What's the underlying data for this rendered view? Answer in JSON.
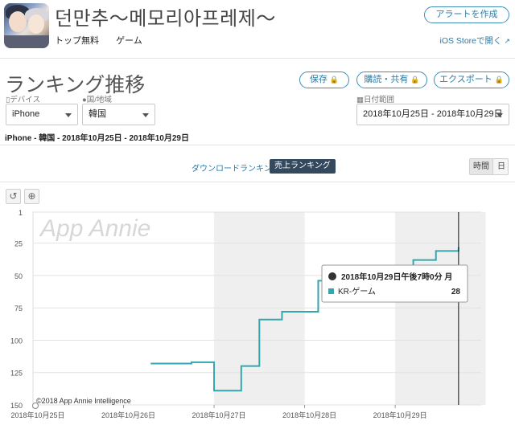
{
  "app": {
    "title": "던만추～메모리아프레제～",
    "price": "トップ無料",
    "category": "ゲーム"
  },
  "header": {
    "alert_button": "アラートを作成",
    "ios_store_link": "iOS Storeで開く"
  },
  "page": {
    "title": "ランキング推移",
    "save_button": "保存",
    "subscribe_button": "購読・共有",
    "export_button": "エクスポート"
  },
  "filters": {
    "device_label": "デバイス",
    "device_value": "iPhone",
    "country_label": "国/地域",
    "country_value": "韓国",
    "date_label": "日付範囲",
    "date_value": "2018年10月25日 - 2018年10月29日"
  },
  "summary": "iPhone - 韓国 - 2018年10月25日 - 2018年10月29日",
  "tabs": {
    "download": "ダウンロードランキング",
    "revenue": "売上ランキング",
    "hourly": "時間",
    "daily": "日"
  },
  "tooltip": {
    "header": "2018年10月29日午後7時0分 月",
    "series": "KR-ゲーム",
    "value": "28"
  },
  "watermark": "App Annie",
  "credit": "©2018 App Annie Intelligence",
  "colors": {
    "accent": "#2b7ca6",
    "series": "#35a6ad",
    "tab_active": "#34495e"
  },
  "chart_data": {
    "type": "line",
    "y_reversed": true,
    "ylim": [
      1,
      150
    ],
    "yticks": [
      "1",
      "25",
      "50",
      "75",
      "100",
      "125",
      "150"
    ],
    "xticks": [
      "2018年10月25日",
      "2018年10月26日",
      "2018年10月27日",
      "2018年10月28日",
      "2018年10月29日"
    ],
    "xlim_days": [
      25,
      29.95
    ],
    "shaded_day": "2018年10月27日",
    "series": [
      {
        "name": "KR-ゲーム",
        "points": [
          [
            26.3,
            118
          ],
          [
            26.75,
            118
          ],
          [
            26.75,
            117
          ],
          [
            27.0,
            117
          ],
          [
            27.0,
            139
          ],
          [
            27.3,
            139
          ],
          [
            27.3,
            120
          ],
          [
            27.5,
            120
          ],
          [
            27.5,
            84
          ],
          [
            27.75,
            84
          ],
          [
            27.75,
            78
          ],
          [
            28.15,
            78
          ],
          [
            28.15,
            54
          ],
          [
            28.3,
            54
          ],
          [
            28.3,
            52
          ],
          [
            28.5,
            52
          ],
          [
            28.5,
            47
          ],
          [
            29.2,
            47
          ],
          [
            29.2,
            38
          ],
          [
            29.45,
            38
          ],
          [
            29.45,
            31
          ],
          [
            29.7,
            31
          ],
          [
            29.7,
            28
          ]
        ]
      }
    ],
    "cursor_x": 29.7
  }
}
